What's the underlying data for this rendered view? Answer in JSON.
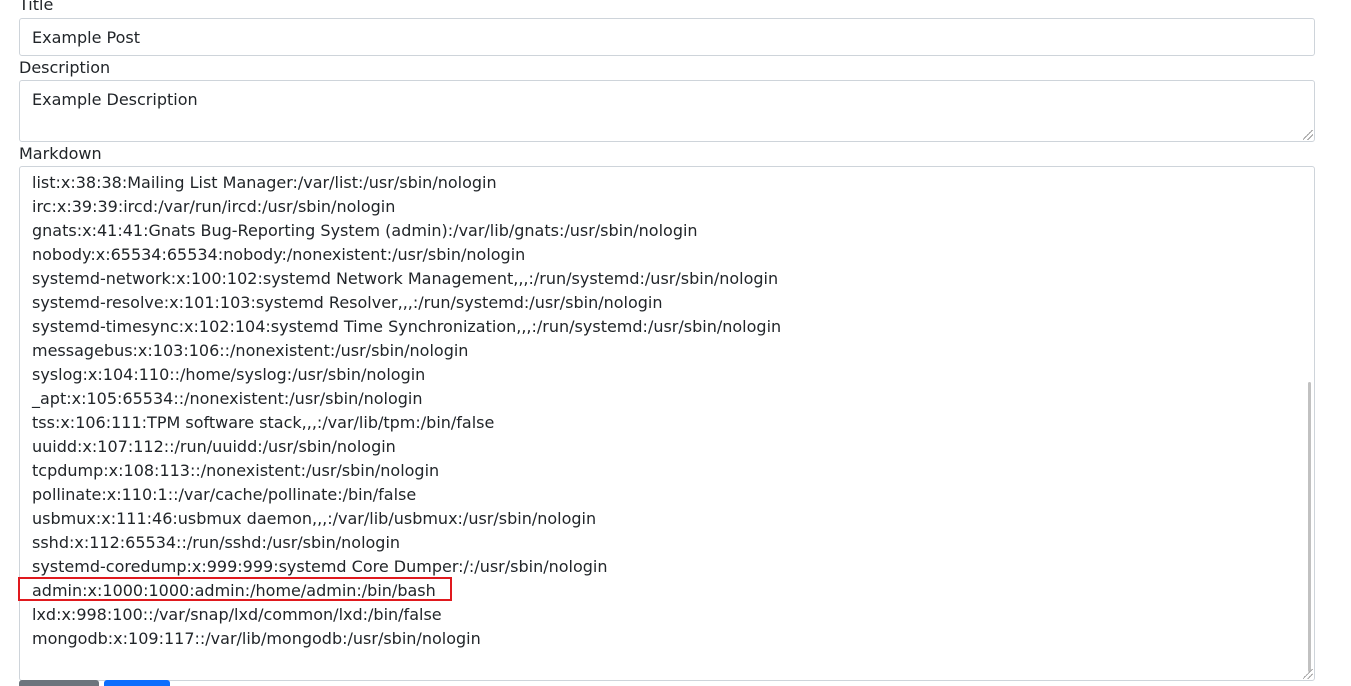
{
  "title": {
    "label": "Title",
    "value": "Example Post"
  },
  "description": {
    "label": "Description",
    "value": "Example Description"
  },
  "markdown": {
    "label": "Markdown",
    "lines": [
      "list:x:38:38:Mailing List Manager:/var/list:/usr/sbin/nologin",
      "irc:x:39:39:ircd:/var/run/ircd:/usr/sbin/nologin",
      "gnats:x:41:41:Gnats Bug-Reporting System (admin):/var/lib/gnats:/usr/sbin/nologin",
      "nobody:x:65534:65534:nobody:/nonexistent:/usr/sbin/nologin",
      "systemd-network:x:100:102:systemd Network Management,,,:/run/systemd:/usr/sbin/nologin",
      "systemd-resolve:x:101:103:systemd Resolver,,,:/run/systemd:/usr/sbin/nologin",
      "systemd-timesync:x:102:104:systemd Time Synchronization,,,:/run/systemd:/usr/sbin/nologin",
      "messagebus:x:103:106::/nonexistent:/usr/sbin/nologin",
      "syslog:x:104:110::/home/syslog:/usr/sbin/nologin",
      "_apt:x:105:65534::/nonexistent:/usr/sbin/nologin",
      "tss:x:106:111:TPM software stack,,,:/var/lib/tpm:/bin/false",
      "uuidd:x:107:112::/run/uuidd:/usr/sbin/nologin",
      "tcpdump:x:108:113::/nonexistent:/usr/sbin/nologin",
      "pollinate:x:110:1::/var/cache/pollinate:/bin/false",
      "usbmux:x:111:46:usbmux daemon,,,:/var/lib/usbmux:/usr/sbin/nologin",
      "sshd:x:112:65534::/run/sshd:/usr/sbin/nologin",
      "systemd-coredump:x:999:999:systemd Core Dumper:/:/usr/sbin/nologin",
      "admin:x:1000:1000:admin:/home/admin:/bin/bash",
      "lxd:x:998:100::/var/snap/lxd/common/lxd:/bin/false",
      "mongodb:x:109:117::/var/lib/mongodb:/usr/sbin/nologin"
    ],
    "highlighted_line": "admin:x:1000:1000:admin:/home/admin:/bin/bash"
  },
  "colors": {
    "highlight": "#e0191e",
    "primary_button": "#0d6efd",
    "secondary_button": "#6c757d"
  }
}
